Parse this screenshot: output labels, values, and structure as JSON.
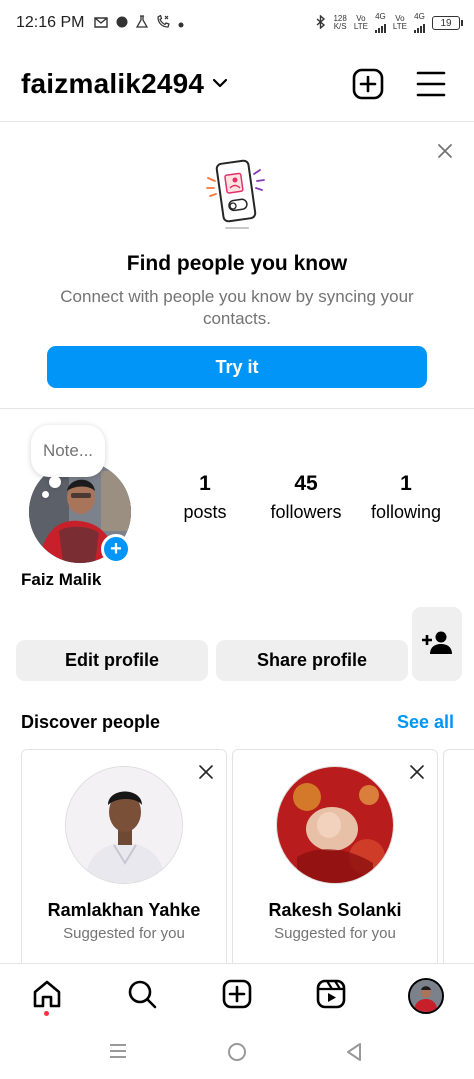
{
  "status_bar": {
    "time": "12:16 PM",
    "net_speed_top": "128",
    "net_speed_bottom": "K/S",
    "sim1_label_top": "Vo",
    "sim1_label_bottom": "LTE",
    "sim1_type": "4G",
    "sim2_label_top": "Vo",
    "sim2_label_bottom": "LTE",
    "sim2_type": "4G",
    "battery": "19"
  },
  "header": {
    "username": "faizmalik2494",
    "icons": [
      "chevron-down-icon",
      "new-post-icon",
      "menu-icon"
    ]
  },
  "find_people": {
    "title": "Find people you know",
    "subtitle": "Connect with people you know by syncing your contacts.",
    "button_label": "Try it"
  },
  "profile": {
    "note_placeholder": "Note...",
    "name": "Faiz Malik",
    "stats": [
      {
        "value": "1",
        "label": "posts"
      },
      {
        "value": "45",
        "label": "followers"
      },
      {
        "value": "1",
        "label": "following"
      }
    ],
    "edit_label": "Edit profile",
    "share_label": "Share profile"
  },
  "discover": {
    "title": "Discover people",
    "see_all": "See all",
    "suggestions": [
      {
        "name": "Ramlakhan Yahke",
        "subtitle": "Suggested for you"
      },
      {
        "name": "Rakesh Solanki",
        "subtitle": "Suggested for you"
      }
    ]
  },
  "bottom_nav": [
    "home-icon",
    "search-icon",
    "create-icon",
    "reels-icon",
    "profile-avatar"
  ],
  "colors": {
    "accent": "#0095f6",
    "button_gray": "#efefef",
    "secondary_text": "#737373",
    "notification_dot": "#ff3040"
  }
}
